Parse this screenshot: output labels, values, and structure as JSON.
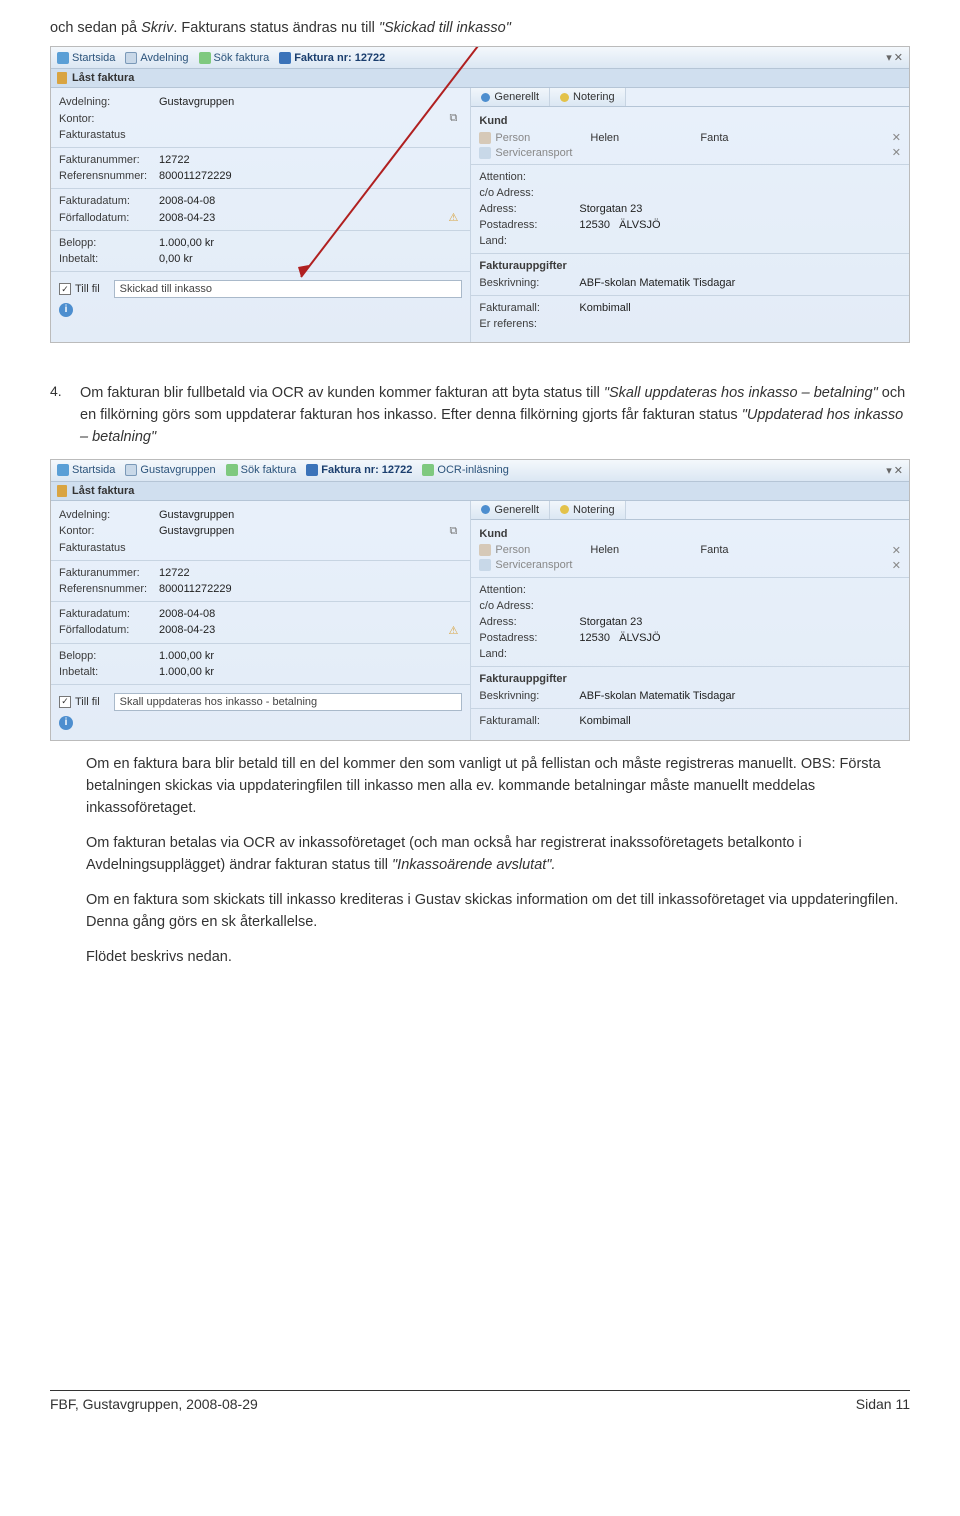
{
  "intro": {
    "prefix": "och sedan på ",
    "skriv": "Skriv",
    "rest": ". Fakturans status ändras nu till ",
    "status": "\"Skickad till inkasso\""
  },
  "shot1": {
    "crumbs": {
      "start": "Startsida",
      "dept": "Avdelning",
      "search": "Sök faktura",
      "fact": "Faktura nr: 12722"
    },
    "title": "Låst faktura",
    "left": {
      "avdelning_l": "Avdelning:",
      "avdelning_v": "Gustavgruppen",
      "kontor_l": "Kontor:",
      "kontor_v": "",
      "fakstat_l": "Fakturastatus",
      "fnr_l": "Fakturanummer:",
      "fnr_v": "12722",
      "ref_l": "Referensnummer:",
      "ref_v": "800011272229",
      "fdat_l": "Fakturadatum:",
      "fdat_v": "2008-04-08",
      "forf_l": "Förfallodatum:",
      "forf_v": "2008-04-23",
      "belopp_l": "Belopp:",
      "belopp_v": "1.000,00 kr",
      "inbet_l": "Inbetalt:",
      "inbet_v": "0,00 kr",
      "till_l": "Till fil",
      "status_v": "Skickad till inkasso"
    },
    "right": {
      "tab1": "Generellt",
      "tab2": "Notering",
      "kund_h": "Kund",
      "person_l": "Person",
      "person_v1": "Helen",
      "person_v2": "Fanta",
      "serv_l": "Serviceransport",
      "att_l": "Attention:",
      "co_l": "c/o Adress:",
      "adr_l": "Adress:",
      "adr_v": "Storgatan 23",
      "post_l": "Postadress:",
      "post_v1": "12530",
      "post_v2": "ÄLVSJÖ",
      "land_l": "Land:",
      "fupp_h": "Fakturauppgifter",
      "beskr_l": "Beskrivning:",
      "beskr_v": "ABF-skolan Matematik Tisdagar",
      "fmall_l": "Fakturamall:",
      "fmall_v": "Kombimall",
      "eref_l": "Er referens:"
    }
  },
  "para4": {
    "num": "4.",
    "t1": "Om fakturan blir fullbetald via OCR av kunden kommer fakturan att byta status till ",
    "skall": "\"Skall uppdateras hos inkasso – betalning\"",
    "t2": " och en filkörning görs som uppdaterar fakturan hos inkasso. Efter denna filkörning gjorts får fakturan status ",
    "upd": "\"Uppdaterad hos inkasso – betalning\""
  },
  "shot2": {
    "crumbs": {
      "start": "Startsida",
      "dept": "Gustavgruppen",
      "search": "Sök faktura",
      "fact": "Faktura nr: 12722",
      "ocr": "OCR-inläsning"
    },
    "title": "Låst faktura",
    "left": {
      "avdelning_l": "Avdelning:",
      "avdelning_v": "Gustavgruppen",
      "kontor_l": "Kontor:",
      "kontor_v": "Gustavgruppen",
      "fakstat_l": "Fakturastatus",
      "fnr_l": "Fakturanummer:",
      "fnr_v": "12722",
      "ref_l": "Referensnummer:",
      "ref_v": "800011272229",
      "fdat_l": "Fakturadatum:",
      "fdat_v": "2008-04-08",
      "forf_l": "Förfallodatum:",
      "forf_v": "2008-04-23",
      "belopp_l": "Belopp:",
      "belopp_v": "1.000,00 kr",
      "inbet_l": "Inbetalt:",
      "inbet_v": "1.000,00 kr",
      "till_l": "Till fil",
      "status_v": "Skall uppdateras hos inkasso - betalning"
    },
    "right": {
      "tab1": "Generellt",
      "tab2": "Notering",
      "kund_h": "Kund",
      "person_l": "Person",
      "person_v1": "Helen",
      "person_v2": "Fanta",
      "serv_l": "Serviceransport",
      "att_l": "Attention:",
      "co_l": "c/o Adress:",
      "adr_l": "Adress:",
      "adr_v": "Storgatan 23",
      "post_l": "Postadress:",
      "post_v1": "12530",
      "post_v2": "ÄLVSJÖ",
      "land_l": "Land:",
      "fupp_h": "Fakturauppgifter",
      "beskr_l": "Beskrivning:",
      "beskr_v": "ABF-skolan Matematik Tisdagar",
      "fmall_l": "Fakturamall:",
      "fmall_v": "Kombimall"
    }
  },
  "body": {
    "p1": "Om en faktura bara blir betald till en del kommer den som vanligt ut på fellistan och måste registreras manuellt. OBS: Första betalningen skickas via uppdateringfilen till inkasso men alla ev. kommande betalningar måste manuellt meddelas inkassoföretaget.",
    "p2a": "Om fakturan betalas via OCR av inkassoföretaget (och man också har registrerat inakssoföretagets betalkonto i Avdelningsupplägget) ändrar fakturan status till ",
    "p2i": "\"Inkassoärende avslutat\".",
    "p3": "Om en faktura som skickats till inkasso krediteras i Gustav skickas information om det till inkassoföretaget via uppdateringfilen. Denna gång görs en sk återkallelse.",
    "p4": "Flödet beskrivs nedan."
  },
  "footer": {
    "left": "FBF, Gustavgruppen, 2008-08-29",
    "right": "Sidan 11"
  }
}
